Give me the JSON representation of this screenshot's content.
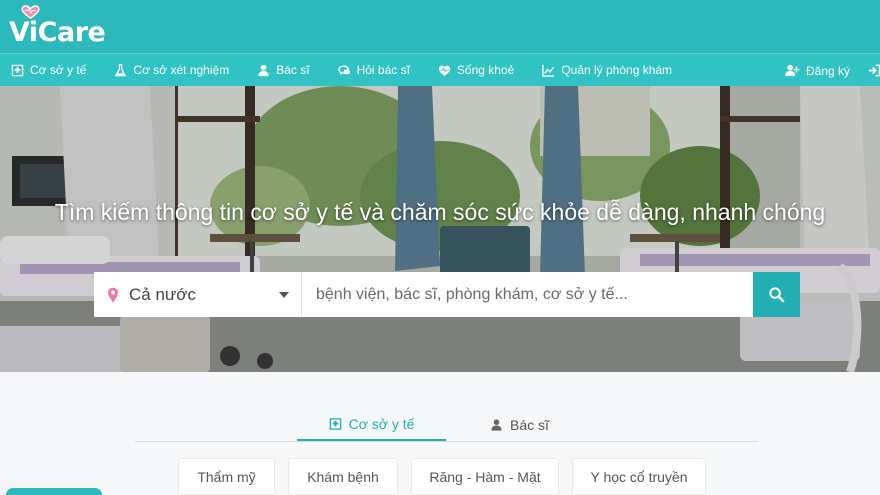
{
  "brand": {
    "name": "ViCare",
    "color": "#2bb9bb",
    "accent": "#22aeb2"
  },
  "nav": {
    "items": [
      {
        "label": "Cơ sở y tế",
        "icon": "hospital-icon"
      },
      {
        "label": "Cơ sở xét nghiệm",
        "icon": "flask-icon"
      },
      {
        "label": "Bác sĩ",
        "icon": "doctor-icon"
      },
      {
        "label": "Hỏi bác sĩ",
        "icon": "chat-icon"
      },
      {
        "label": "Sống khoẻ",
        "icon": "heartbeat-icon"
      },
      {
        "label": "Quản lý phòng khám",
        "icon": "chart-icon"
      }
    ],
    "register_label": "Đăng ký",
    "register_icon": "user-plus-icon",
    "login_icon": "sign-in-icon"
  },
  "hero": {
    "title": "Tìm kiếm thông tin cơ sở y tế và chăm sóc sức khỏe dễ dàng, nhanh chóng"
  },
  "search": {
    "location_value": "Cả nước",
    "placeholder": "bệnh viện, bác sĩ, phòng khám, cơ sở y tế..."
  },
  "tabs": [
    {
      "label": "Cơ sở y tế",
      "icon": "hospital-icon",
      "active": true
    },
    {
      "label": "Bác sĩ",
      "icon": "doctor-icon",
      "active": false
    }
  ],
  "categories": [
    "Thẩm mỹ",
    "Khám bệnh",
    "Răng - Hàm - Mặt",
    "Y học cổ truyền"
  ]
}
